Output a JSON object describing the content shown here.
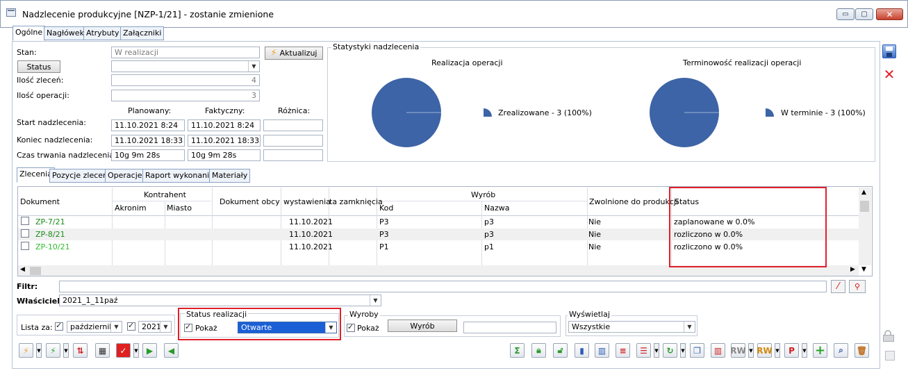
{
  "window": {
    "title": "Nadzlecenie produkcyjne [NZP-1/21] - zostanie zmienione",
    "min_glyph": "▭",
    "max_glyph": "▢",
    "close_glyph": "✕"
  },
  "tabs_top": [
    "Ogólne",
    "Nagłówek",
    "Atrybuty",
    "Załączniki"
  ],
  "form": {
    "stan_label": "Stan:",
    "stan_value": "W realizacji",
    "aktualizuj_label": "Aktualizuj",
    "status_button": "Status",
    "ilosc_zlecen_label": "Ilość zleceń:",
    "ilosc_zlecen_value": "4",
    "ilosc_operacji_label": "Ilość operacji:",
    "ilosc_operacji_value": "3",
    "col_planowany": "Planowany:",
    "col_faktyczny": "Faktyczny:",
    "col_roznica": "Różnica:",
    "start_label": "Start nadzlecenia:",
    "start_plan": "11.10.2021 8:24",
    "start_fakt": "11.10.2021 8:24",
    "koniec_label": "Koniec nadzlecenia:",
    "koniec_plan": "11.10.2021 18:33",
    "koniec_fakt": "11.10.2021 18:33",
    "czas_label": "Czas trwania nadzlecenia:",
    "czas_plan": "10g 9m 28s",
    "czas_fakt": "10g 9m 28s"
  },
  "stats": {
    "group_title": "Statystyki nadzlecenia",
    "chart1_title": "Realizacja operacji",
    "chart1_legend": "Zrealizowane - 3 (100%)",
    "chart2_title": "Terminowość realizacji operacji",
    "chart2_legend": "W terminie - 3 (100%)",
    "pie_color": "#3d64a6"
  },
  "chart_data": [
    {
      "type": "pie",
      "title": "Realizacja operacji",
      "categories": [
        "Zrealizowane"
      ],
      "values": [
        3
      ],
      "legend": [
        "Zrealizowane - 3 (100%)"
      ],
      "legend_position": "right"
    },
    {
      "type": "pie",
      "title": "Terminowość realizacji operacji",
      "categories": [
        "W terminie"
      ],
      "values": [
        3
      ],
      "legend": [
        "W terminie - 3 (100%)"
      ],
      "legend_position": "right"
    }
  ],
  "tabs_lower": [
    "Zlecenia",
    "Pozycje zleceń",
    "Operacje",
    "Raport wykonania",
    "Materiały"
  ],
  "grid": {
    "headers": {
      "dokument": "Dokument",
      "kontrahent": "Kontrahent",
      "akronim": "Akronim",
      "miasto": "Miasto",
      "dokument_obcy": "Dokument obcy",
      "wystawienia": "wystawienia",
      "zamkniecia": "ta zamknięcia",
      "wyrob": "Wyrób",
      "kod": "Kod",
      "nazwa": "Nazwa",
      "zwolnione": "Zwolnione do produkcji",
      "status": "Status"
    },
    "rows": [
      {
        "dokument": "ZP-7/21",
        "wystawienia": "11.10.2021",
        "kod": "P3",
        "nazwa": "p3",
        "zwolnione": "Nie",
        "status": "zaplanowane w 0.0%"
      },
      {
        "dokument": "ZP-8/21",
        "wystawienia": "11.10.2021",
        "kod": "P3",
        "nazwa": "p3",
        "zwolnione": "Nie",
        "status": "rozliczono w 0.0%"
      },
      {
        "dokument": "ZP-10/21",
        "wystawienia": "11.10.2021",
        "kod": "P1",
        "nazwa": "p1",
        "zwolnione": "Nie",
        "status": "rozliczono w 0.0%"
      }
    ]
  },
  "filters": {
    "filtr_label": "Filtr:",
    "filtr_value": "",
    "wlasciciel_label": "Właściciel:",
    "wlasciciel_value": "2021_1_11paź",
    "lista_za_label": "Lista za:",
    "miesiac": "październik",
    "rok": "2021",
    "status_realizacji_title": "Status realizacji",
    "pokaz_label": "Pokaż",
    "status_value": "Otwarte",
    "wyroby_title": "Wyroby",
    "wyroby_pokaz": "Pokaż",
    "wyrob_button": "Wyrób",
    "wyrob_value": "",
    "wyswietlaj_title": "Wyświetlaj",
    "wyswietlaj_value": "Wszystkie"
  },
  "toolbar": {
    "rw_label": "RW",
    "p_label": "P"
  }
}
